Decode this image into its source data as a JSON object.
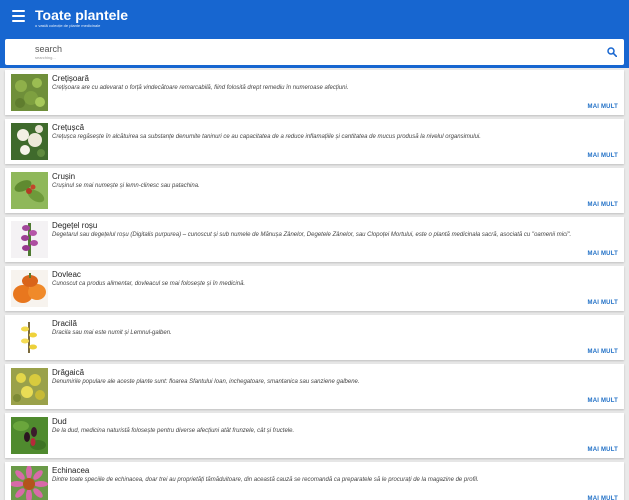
{
  "app": {
    "title": "Toate plantele",
    "subtitle": "o vastă colecție de plante medicinale"
  },
  "search": {
    "label": "search",
    "placeholder": "searching..."
  },
  "colors": {
    "appbar": "#1766d0",
    "link": "#1f6fc6"
  },
  "more_label": "MAI MULT",
  "plants": [
    {
      "name": "Crețișoară",
      "description": "Crețișoara are cu adevarat o forță vindecătoare remarcabilă, fiind folosită drept remediu în numeroase afecțiuni.",
      "icon": "lady-mantle-icon"
    },
    {
      "name": "Crețușcă",
      "description": "Crețușca regăsește în alcătuirea sa substanțe denumite taninuri ce au capacitatea de a reduce inflamațiile și cantitatea de mucus produsă la nivelul organsimului.",
      "icon": "meadowsweet-icon"
    },
    {
      "name": "Crușin",
      "description": "Crușinul se mai numește și lemn-clinesc sau patachina.",
      "icon": "buckthorn-icon"
    },
    {
      "name": "Degețel roșu",
      "description": "Degetarul sau degețelul roșu (Digitalis purpurea) – cunoscut și sub numele de Mănușa Zânelor, Degetele Zânelor, sau Clopoței Mortului, este o plantă medicinala sacră, asociată cu \"oamenii mici\".",
      "icon": "foxglove-icon"
    },
    {
      "name": "Dovleac",
      "description": "Cunoscut ca produs alimentar, dovleacul se mai folosește și în medicină.",
      "icon": "pumpkin-icon"
    },
    {
      "name": "Dracilă",
      "description": "Dracila sau mai este numit și Lemnul-galben.",
      "icon": "barberry-icon"
    },
    {
      "name": "Drăgaică",
      "description": "Denumirile populare ale aceste plante sunt: floarea Sfantului Ioan, inchegatoare, smantanica sau sanziene galbene.",
      "icon": "yellow-bedstraw-icon"
    },
    {
      "name": "Dud",
      "description": "De la dud, medicina naturistă folosește pentru diverse afecțiuni atât frunzele, cât și fructele.",
      "icon": "mulberry-icon"
    },
    {
      "name": "Echinacea",
      "description": "Dintre toate speciile de echinacea, doar trei au proprietăți tămăduitoare, din această cauză se recomandă ca preparatele să le procurați de la magazine de profil.",
      "icon": "echinacea-icon"
    }
  ]
}
